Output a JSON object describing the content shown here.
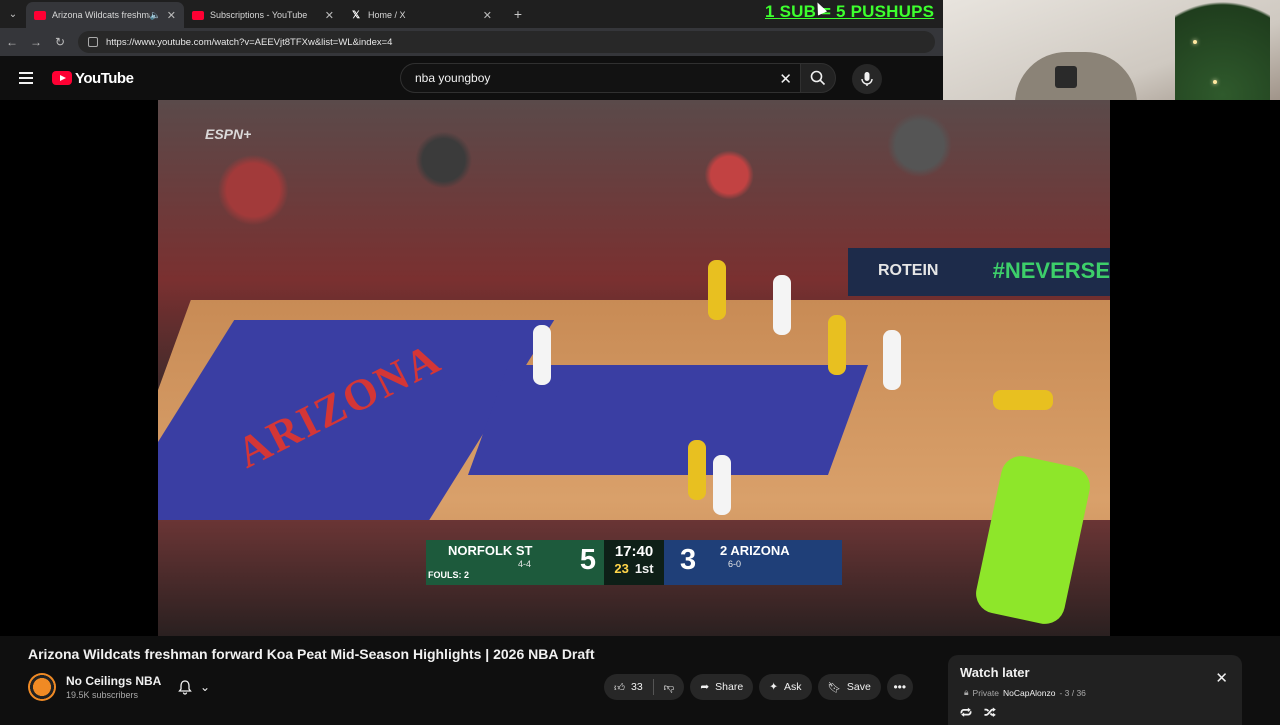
{
  "browser": {
    "tabs": [
      {
        "title": "Arizona Wildcats freshman",
        "active": true
      },
      {
        "title": "Subscriptions - YouTube",
        "active": false
      },
      {
        "title": "Home / X",
        "active": false
      }
    ],
    "url": "https://www.youtube.com/watch?v=AEEVjt8TFXw&list=WL&index=4"
  },
  "overlay": {
    "text": "1 SUB = 5 PUSHUPS",
    "color": "#3dff2e"
  },
  "youtube": {
    "logo_text": "YouTube",
    "search_value": "nba youngboy"
  },
  "video": {
    "watermark": "ESPN+",
    "court_text": "ARIZONA",
    "banner_text": "#NEVERSE",
    "banner_text2": "ROTEIN"
  },
  "scoreboard": {
    "home_team": "NORFOLK ST",
    "home_record": "4-4",
    "home_score": "5",
    "home_fouls": "FOULS: 2",
    "clock": "17:40",
    "shot_clock": "23",
    "period": "1st",
    "away_rank": "2",
    "away_team": "ARIZONA",
    "away_record": "6-0",
    "away_score": "3"
  },
  "details": {
    "title": "Arizona Wildcats freshman forward Koa Peat Mid-Season Highlights | 2026 NBA Draft",
    "channel": "No Ceilings NBA",
    "subscribers": "19.5K subscribers",
    "likes": "33",
    "share_label": "Share",
    "ask_label": "Ask",
    "save_label": "Save"
  },
  "playlist": {
    "title": "Watch later",
    "privacy": "Private",
    "owner": "NoCapAlonzo",
    "position": "- 3 / 36"
  }
}
